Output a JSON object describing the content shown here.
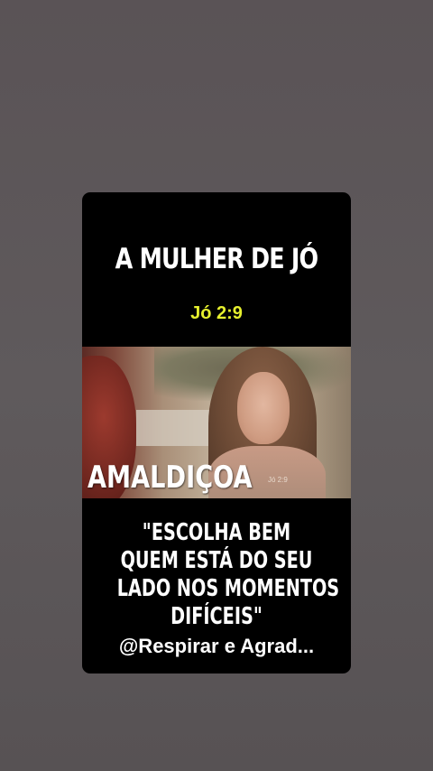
{
  "post": {
    "title": "A MULHER DE JÓ",
    "verse_ref": "Jó 2:9",
    "video_caption": "AMALDIÇOA",
    "video_watermark": "Jó 2:9",
    "quote_lines": [
      "\"ESCOLHA BEM",
      "QUEM ESTÁ DO SEU",
      "LADO NOS MOMENTOS",
      "DIFÍCEIS\""
    ],
    "handle": "@Respirar e Agrad..."
  },
  "colors": {
    "background": "#5d5759",
    "card": "#000000",
    "verse_accent": "#e6f02e",
    "text": "#ffffff"
  }
}
